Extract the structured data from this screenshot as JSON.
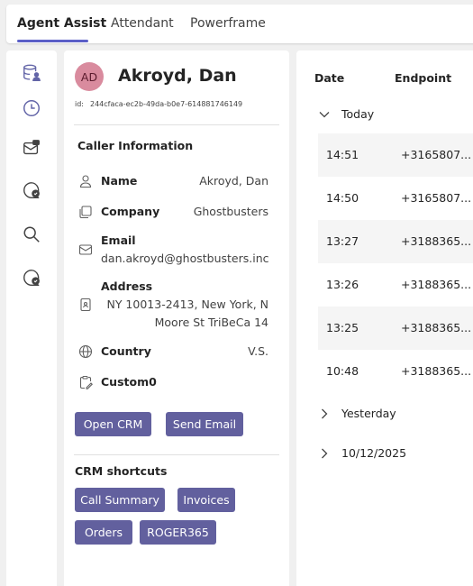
{
  "tabs": [
    {
      "label": "Agent Assist",
      "active": true
    },
    {
      "label": "Attendant",
      "active": false
    },
    {
      "label": "Powerframe",
      "active": false
    }
  ],
  "rail": {
    "icons": [
      "contact-card-icon",
      "history-icon",
      "inbox-icon",
      "chat-check-icon",
      "search-icon",
      "chat-check-icon"
    ]
  },
  "caller": {
    "initials": "AD",
    "name": "Akroyd, Dan",
    "id_label": "id:",
    "id": "244cfaca-ec2b-49da-b0e7-614881746149",
    "section_title": "Caller Information",
    "fields": {
      "name": {
        "label": "Name",
        "value": "Akroyd, Dan"
      },
      "company": {
        "label": "Company",
        "value": "Ghostbusters"
      },
      "email": {
        "label": "Email",
        "value": "dan.akroyd@ghostbusters.inc"
      },
      "address": {
        "label": "Address",
        "line1": "NY 10013-2413, New York, N",
        "line2": "Moore St TriBeCa 14"
      },
      "country": {
        "label": "Country",
        "value": "V.S."
      },
      "custom0": {
        "label": "Custom0",
        "value": ""
      }
    },
    "buttons": {
      "open_crm": "Open CRM",
      "send_email": "Send Email"
    },
    "shortcuts_title": "CRM shortcuts",
    "shortcuts": [
      "Call Summary",
      "Invoices",
      "Orders",
      "ROGER365"
    ]
  },
  "history": {
    "columns": {
      "date": "Date",
      "endpoint": "Endpoint"
    },
    "today_label": "Today",
    "rows": [
      {
        "time": "14:51",
        "endpoint": "+3165807..."
      },
      {
        "time": "14:50",
        "endpoint": "+3165807..."
      },
      {
        "time": "13:27",
        "endpoint": "+3188365..."
      },
      {
        "time": "13:26",
        "endpoint": "+3188365..."
      },
      {
        "time": "13:25",
        "endpoint": "+3188365..."
      },
      {
        "time": "10:48",
        "endpoint": "+3188365..."
      }
    ],
    "collapsed_groups": [
      "Yesterday",
      "10/12/2025"
    ]
  },
  "colors": {
    "accent": "#5b5fc7",
    "button": "#62609e",
    "avatar": "#d98b9e"
  }
}
